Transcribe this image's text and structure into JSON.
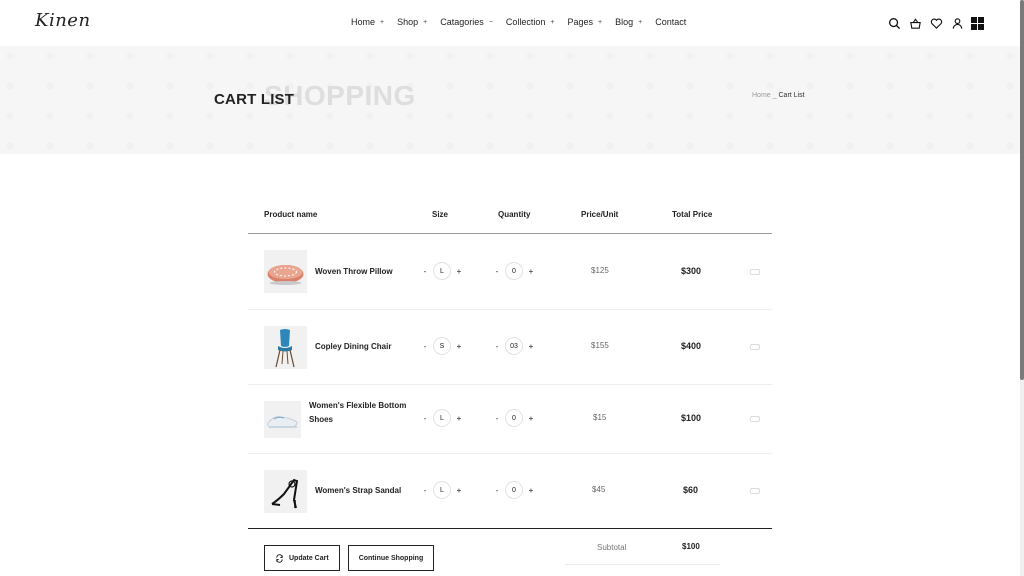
{
  "header": {
    "logo": "Kinen",
    "nav": [
      {
        "label": "Home",
        "marker": "+"
      },
      {
        "label": "Shop",
        "marker": "+"
      },
      {
        "label": "Catagories",
        "marker": "−"
      },
      {
        "label": "Collection",
        "marker": "+"
      },
      {
        "label": "Pages",
        "marker": "+"
      },
      {
        "label": "Blog",
        "marker": "+"
      },
      {
        "label": "Contact",
        "marker": ""
      }
    ],
    "icons": [
      "search-icon",
      "basket-icon",
      "heart-icon",
      "user-icon",
      "grid-menu-icon"
    ]
  },
  "banner": {
    "title": "CART LIST",
    "background_text": "SHOPPING",
    "breadcrumb": {
      "home": "Home",
      "separator": "_",
      "current": "Cart List"
    }
  },
  "table": {
    "headers": {
      "product": "Product name",
      "size": "Size",
      "quantity": "Quantity",
      "price": "Price/Unit",
      "total": "Total Price"
    },
    "rows": [
      {
        "name": "Woven Throw Pillow",
        "size": "L",
        "quantity": "0",
        "price": "$125",
        "total": "$300",
        "image": "pillow"
      },
      {
        "name": "Copley Dining Chair",
        "size": "S",
        "quantity": "03",
        "price": "$155",
        "total": "$400",
        "image": "chair"
      },
      {
        "name": "Women's Flexible Bottom Shoes",
        "size": "L",
        "quantity": "0",
        "price": "$15",
        "total": "$100",
        "image": "shoes"
      },
      {
        "name": "Women's Strap Sandal",
        "size": "L",
        "quantity": "0",
        "price": "$45",
        "total": "$60",
        "image": "sandal"
      }
    ],
    "stepper": {
      "minus": "-",
      "plus": "+"
    }
  },
  "actions": {
    "update": "Update Cart",
    "continue": "Continue Shopping"
  },
  "summary": {
    "subtotal_label": "Subtotal",
    "subtotal_value": "$100"
  }
}
